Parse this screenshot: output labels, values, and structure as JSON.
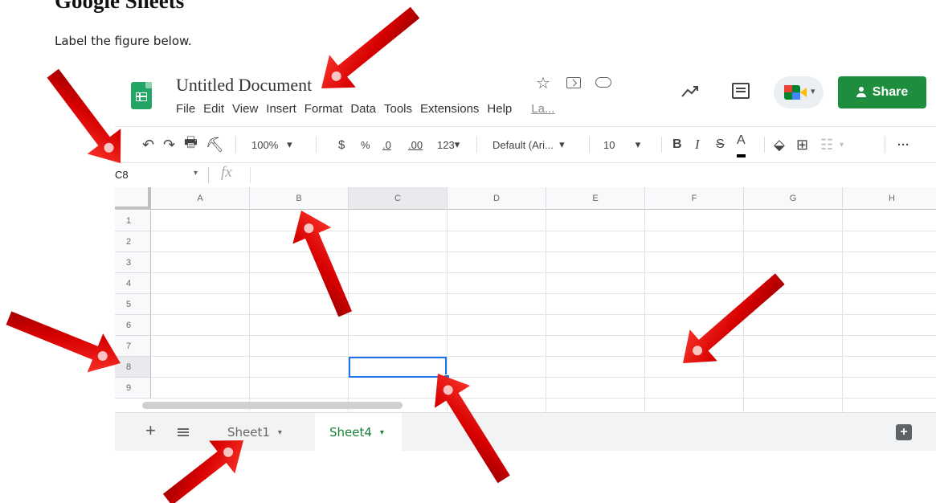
{
  "document": {
    "title": "Google Sheets",
    "instruction": "Label the figure below."
  },
  "header": {
    "file_name": "Untitled Document",
    "menu": [
      "File",
      "Edit",
      "View",
      "Insert",
      "Format",
      "Data",
      "Tools",
      "Extensions",
      "Help",
      "La..."
    ],
    "share_label": "Share"
  },
  "toolbar": {
    "zoom": "100%",
    "currency": "$",
    "percent": "%",
    "decrease_decimal": ".0",
    "increase_decimal": ".00",
    "more_formats": "123",
    "font": "Default (Ari...",
    "font_size": "10",
    "bold": "B",
    "italic": "I",
    "strikethrough": "S",
    "text_color": "A",
    "more": "···"
  },
  "formula_bar": {
    "name_box": "C8",
    "fx": "fx"
  },
  "grid": {
    "columns": [
      "A",
      "B",
      "C",
      "D",
      "E",
      "F",
      "G",
      "H"
    ],
    "rows": [
      "1",
      "2",
      "3",
      "4",
      "5",
      "6",
      "7",
      "8",
      "9"
    ],
    "selected_cell": "C8"
  },
  "sheets": {
    "tabs": [
      {
        "label": "Sheet1",
        "active": false
      },
      {
        "label": "Sheet4",
        "active": true
      }
    ]
  },
  "colors": {
    "sheets_green": "#23a566",
    "share_green": "#1e8e3e",
    "selection_blue": "#1a73e8",
    "arrow_red": "#d90000"
  }
}
